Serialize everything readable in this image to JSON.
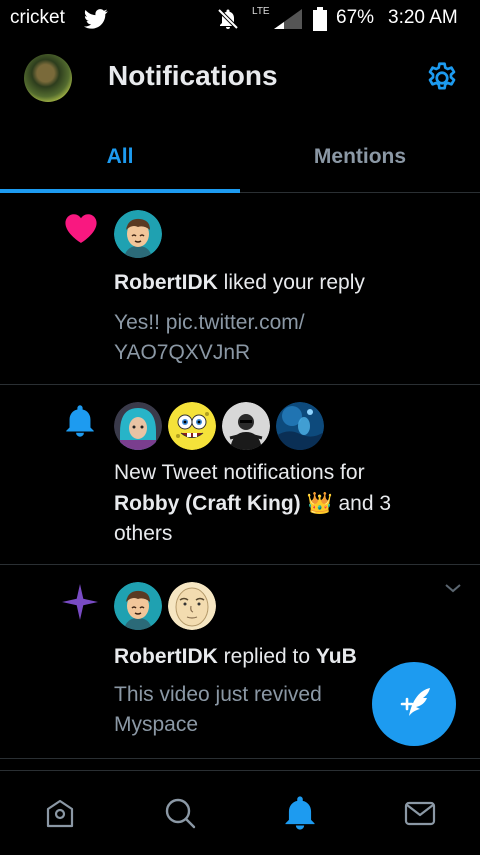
{
  "status_bar": {
    "carrier": "cricket",
    "network": "LTE",
    "battery": "67%",
    "time": "3:20 AM",
    "icons": [
      "twitter-bird-icon",
      "mute-notifications-icon",
      "signal-icon",
      "battery-icon"
    ]
  },
  "header": {
    "title": "Notifications",
    "settings_icon": "gear-icon"
  },
  "tabs": [
    {
      "label": "All",
      "active": true
    },
    {
      "label": "Mentions",
      "active": false
    }
  ],
  "notifications": [
    {
      "icon": "heart-icon",
      "user": "RobertIDK",
      "action": " liked your reply",
      "preview_line1": "Yes!! pic.twitter.com/",
      "preview_line2": "YAO7QXVJnR"
    },
    {
      "icon": "bell-icon",
      "text_prefix": "New Tweet notifications for",
      "user": "Robby (Craft King)",
      "emoji": "👑",
      "text_suffix": " and 3",
      "text_line3": "others"
    },
    {
      "icon": "sparkle-icon",
      "user": "RobertIDK",
      "action": " replied to ",
      "target": "YuB",
      "preview_line1": "This video just revived",
      "preview_line2": "Myspace"
    }
  ],
  "fab": {
    "icon": "compose-tweet-icon"
  },
  "bottom_nav": [
    "home-icon",
    "search-icon",
    "notifications-bell-icon",
    "messages-icon"
  ],
  "colors": {
    "accent": "#1d9bf0",
    "heart": "#f91880",
    "sparkle": "#794bc4",
    "secondary_text": "#8b98a5",
    "divider": "#2a2f33"
  }
}
